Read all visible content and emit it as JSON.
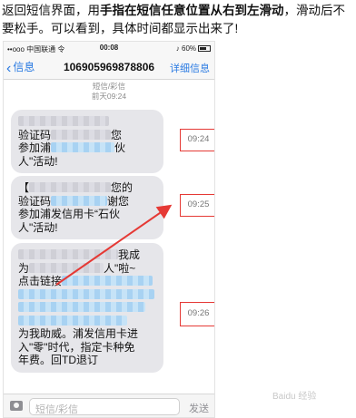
{
  "caption": {
    "part1": "返回短信界面，用",
    "bold": "手指在短信任意位置从右到左滑动",
    "part2": "，滑动后不要松手。可以看到，具体时间都显示出来了!"
  },
  "status_bar": {
    "carrier": "••ooo 中国联通 令",
    "time": "00:08",
    "battery": "♪ 60%"
  },
  "nav": {
    "back_label": "信息",
    "title": "106905969878806",
    "detail_label": "详细信息"
  },
  "meta": {
    "type_label": "短信/彩信",
    "date_label": "前天09:24"
  },
  "messages": [
    {
      "lines": [
        {
          "t1": "验证码",
          "t2": "您"
        },
        {
          "t1": "参加浦",
          "t2": "伙"
        },
        {
          "t1": "人\"活动!",
          "t2": ""
        }
      ],
      "time": "09:24"
    },
    {
      "lines": [
        {
          "t1": "【",
          "t2": "您的"
        },
        {
          "t1": "验证码",
          "t2": "谢您"
        },
        {
          "t1": "参加浦发信用卡“石伙",
          "t2": ""
        },
        {
          "t1": "人\"活动!",
          "t2": ""
        }
      ],
      "time": "09:25"
    },
    {
      "lines": [
        {
          "t1": "",
          "t2": "我成"
        },
        {
          "t1": "为",
          "t2": "人\"啦~"
        },
        {
          "t1": "点击链接",
          "t2": ""
        },
        {
          "t1": "为我助威。浦发信用卡进",
          "t2": ""
        },
        {
          "t1": "入\"零\"时代，指定卡种免",
          "t2": ""
        },
        {
          "t1": "年费。回TD退订",
          "t2": ""
        }
      ],
      "time": "09:26"
    }
  ],
  "bottom_bar": {
    "input_placeholder": "短信/彩信",
    "send_label": "发送"
  },
  "watermark": "Baidu 经验",
  "colors": {
    "accent_blue": "#2a7ae2",
    "highlight_red": "#e53935",
    "bubble_gray": "#e6e6ea"
  }
}
